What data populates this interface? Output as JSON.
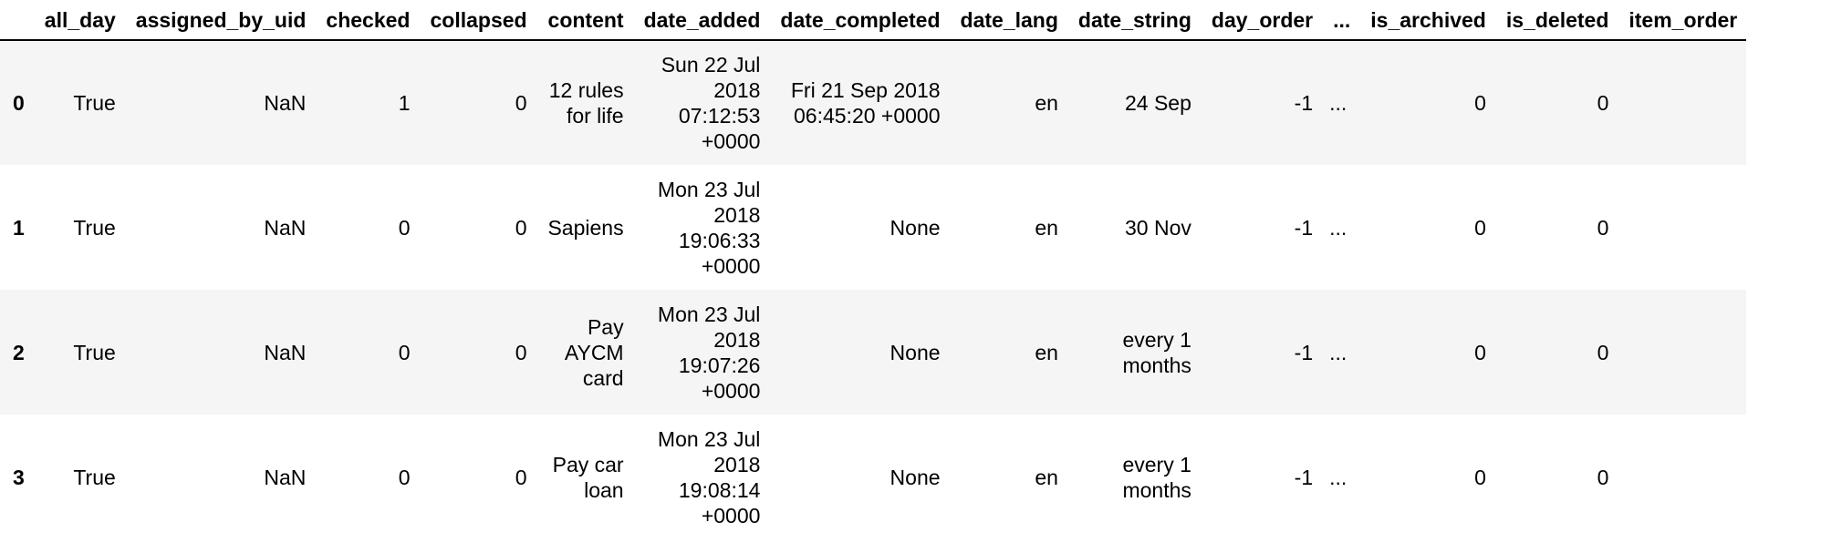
{
  "table": {
    "columns": [
      "",
      "all_day",
      "assigned_by_uid",
      "checked",
      "collapsed",
      "content",
      "date_added",
      "date_completed",
      "date_lang",
      "date_string",
      "day_order",
      "...",
      "is_archived",
      "is_deleted",
      "item_order"
    ],
    "rows": [
      {
        "index": "0",
        "all_day": "True",
        "assigned_by_uid": "NaN",
        "checked": "1",
        "collapsed": "0",
        "content": "12 rules for life",
        "date_added": "Sun 22 Jul 2018 07:12:53 +0000",
        "date_completed": "Fri 21 Sep 2018 06:45:20 +0000",
        "date_lang": "en",
        "date_string": "24 Sep",
        "day_order": "-1",
        "ellipsis": "...",
        "is_archived": "0",
        "is_deleted": "0",
        "item_order": ""
      },
      {
        "index": "1",
        "all_day": "True",
        "assigned_by_uid": "NaN",
        "checked": "0",
        "collapsed": "0",
        "content": "Sapiens",
        "date_added": "Mon 23 Jul 2018 19:06:33 +0000",
        "date_completed": "None",
        "date_lang": "en",
        "date_string": "30 Nov",
        "day_order": "-1",
        "ellipsis": "...",
        "is_archived": "0",
        "is_deleted": "0",
        "item_order": ""
      },
      {
        "index": "2",
        "all_day": "True",
        "assigned_by_uid": "NaN",
        "checked": "0",
        "collapsed": "0",
        "content": "Pay AYCM card",
        "date_added": "Mon 23 Jul 2018 19:07:26 +0000",
        "date_completed": "None",
        "date_lang": "en",
        "date_string": "every 1 months",
        "day_order": "-1",
        "ellipsis": "...",
        "is_archived": "0",
        "is_deleted": "0",
        "item_order": ""
      },
      {
        "index": "3",
        "all_day": "True",
        "assigned_by_uid": "NaN",
        "checked": "0",
        "collapsed": "0",
        "content": "Pay car loan",
        "date_added": "Mon 23 Jul 2018 19:08:14 +0000",
        "date_completed": "None",
        "date_lang": "en",
        "date_string": "every 1 months",
        "day_order": "-1",
        "ellipsis": "...",
        "is_archived": "0",
        "is_deleted": "0",
        "item_order": ""
      }
    ]
  }
}
